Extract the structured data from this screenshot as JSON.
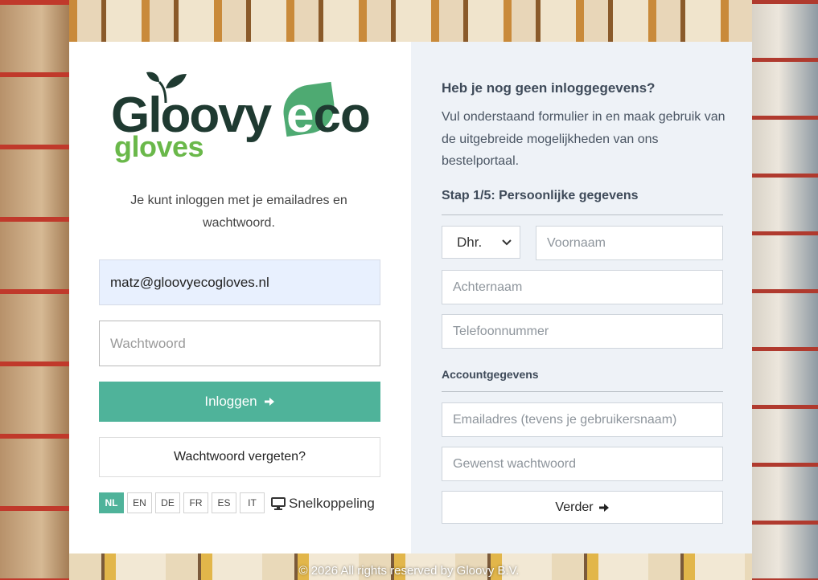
{
  "logo": {
    "text_main": "Gloovy",
    "text_eco_e": "e",
    "text_eco_rest": "co",
    "text_gloves": "gloves"
  },
  "login": {
    "intro": "Je kunt inloggen met je emailadres en wachtwoord.",
    "email_value": "matz@gloovyecogloves.nl",
    "password_placeholder": "Wachtwoord",
    "login_label": "Inloggen",
    "forgot_label": "Wachtwoord vergeten?",
    "languages": [
      "NL",
      "EN",
      "DE",
      "FR",
      "ES",
      "IT"
    ],
    "active_language": "NL",
    "shortcut_label": "Snelkoppeling"
  },
  "register": {
    "title": "Heb je nog geen inloggegevens?",
    "text": "Vul onderstaand formulier in en maak gebruik van de uitgebreide mogelijkheden van ons bestelportaal.",
    "step": "Stap 1/5: Persoonlijke gegevens",
    "salutation": "Dhr.",
    "firstname_placeholder": "Voornaam",
    "lastname_placeholder": "Achternaam",
    "phone_placeholder": "Telefoonnummer",
    "account_heading": "Accountgegevens",
    "email_placeholder": "Emailadres (tevens je gebruikersnaam)",
    "password_placeholder": "Gewenst wachtwoord",
    "next_label": "Verder"
  },
  "footer": {
    "copyright": "© 2026 All rights reserved by Gloovy B.V."
  },
  "colors": {
    "accent": "#4fb39a",
    "logo_dark": "#1f3a31",
    "logo_green": "#6ab84a",
    "right_panel_bg": "#eef2f7"
  }
}
